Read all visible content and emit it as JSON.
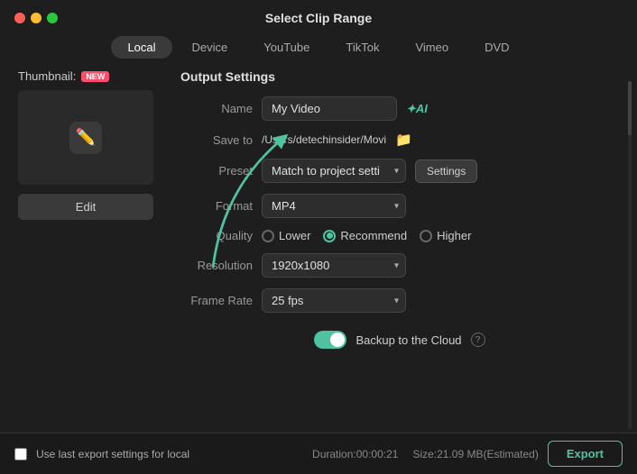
{
  "window": {
    "title": "Select Clip Range"
  },
  "tabs": [
    {
      "id": "local",
      "label": "Local",
      "active": true
    },
    {
      "id": "device",
      "label": "Device",
      "active": false
    },
    {
      "id": "youtube",
      "label": "YouTube",
      "active": false
    },
    {
      "id": "tiktok",
      "label": "TikTok",
      "active": false
    },
    {
      "id": "vimeo",
      "label": "Vimeo",
      "active": false
    },
    {
      "id": "dvd",
      "label": "DVD",
      "active": false
    }
  ],
  "thumbnail": {
    "label": "Thumbnail:",
    "new_badge": "NEW",
    "edit_button": "Edit"
  },
  "output_settings": {
    "section_title": "Output Settings",
    "name_label": "Name",
    "name_value": "My Video",
    "save_to_label": "Save to",
    "save_to_path": "/Users/detechinsider/Movi",
    "preset_label": "Preset",
    "preset_value": "Match to project settings",
    "settings_button": "Settings",
    "format_label": "Format",
    "format_value": "MP4",
    "quality_label": "Quality",
    "quality_options": [
      {
        "id": "lower",
        "label": "Lower",
        "selected": false
      },
      {
        "id": "recommend",
        "label": "Recommend",
        "selected": true
      },
      {
        "id": "higher",
        "label": "Higher",
        "selected": false
      }
    ],
    "resolution_label": "Resolution",
    "resolution_value": "1920x1080",
    "frame_rate_label": "Frame Rate",
    "frame_rate_value": "25 fps",
    "backup_label": "Backup to the Cloud",
    "backup_enabled": true
  },
  "footer": {
    "checkbox_label": "Use last export settings for local",
    "duration": "Duration:00:00:21",
    "size": "Size:21.09 MB(Estimated)",
    "export_button": "Export"
  },
  "colors": {
    "accent": "#4fc3a1",
    "background": "#1e1e1e",
    "panel": "#2d2d2d"
  }
}
